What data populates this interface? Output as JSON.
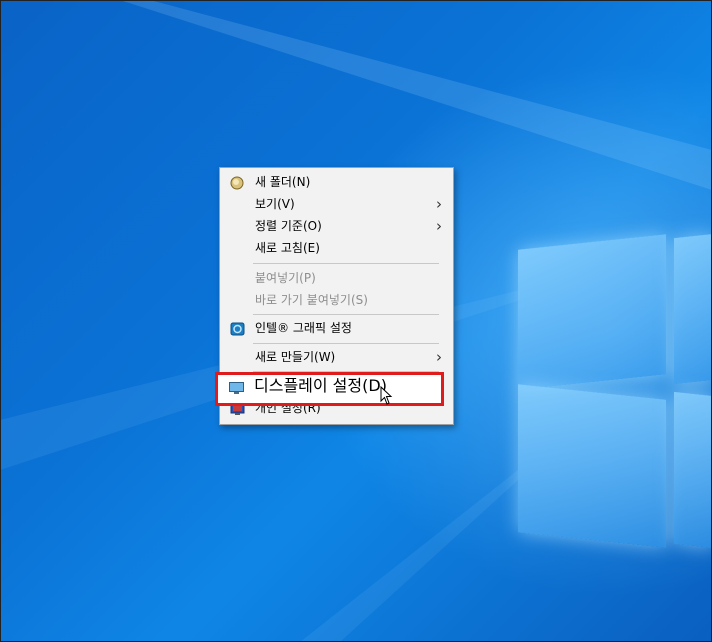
{
  "context_menu": {
    "items": [
      {
        "label": "새 폴더(N)",
        "icon": "new-folder-icon",
        "disabled": false,
        "submenu": false
      },
      {
        "label": "보기(V)",
        "icon": "",
        "disabled": false,
        "submenu": true
      },
      {
        "label": "정렬 기준(O)",
        "icon": "",
        "disabled": false,
        "submenu": true
      },
      {
        "label": "새로 고침(E)",
        "icon": "",
        "disabled": false,
        "submenu": false
      },
      {
        "label": "붙여넣기(P)",
        "icon": "",
        "disabled": true,
        "submenu": false
      },
      {
        "label": "바로 가기 붙여넣기(S)",
        "icon": "",
        "disabled": true,
        "submenu": false
      },
      {
        "label": "인텔® 그래픽 설정",
        "icon": "intel-graphics-icon",
        "disabled": false,
        "submenu": false
      },
      {
        "label": "새로 만들기(W)",
        "icon": "",
        "disabled": false,
        "submenu": true
      },
      {
        "label": "디스플레이 설정(D)",
        "icon": "display-icon",
        "disabled": false,
        "submenu": false
      },
      {
        "label": "개인 설정(R)",
        "icon": "personalize-icon",
        "disabled": false,
        "submenu": false
      }
    ],
    "submenu_arrow": "›"
  },
  "colors": {
    "desktop_blue": "#0b73d6",
    "highlight_red": "#e01b1b",
    "menu_bg": "#f2f2f2"
  }
}
